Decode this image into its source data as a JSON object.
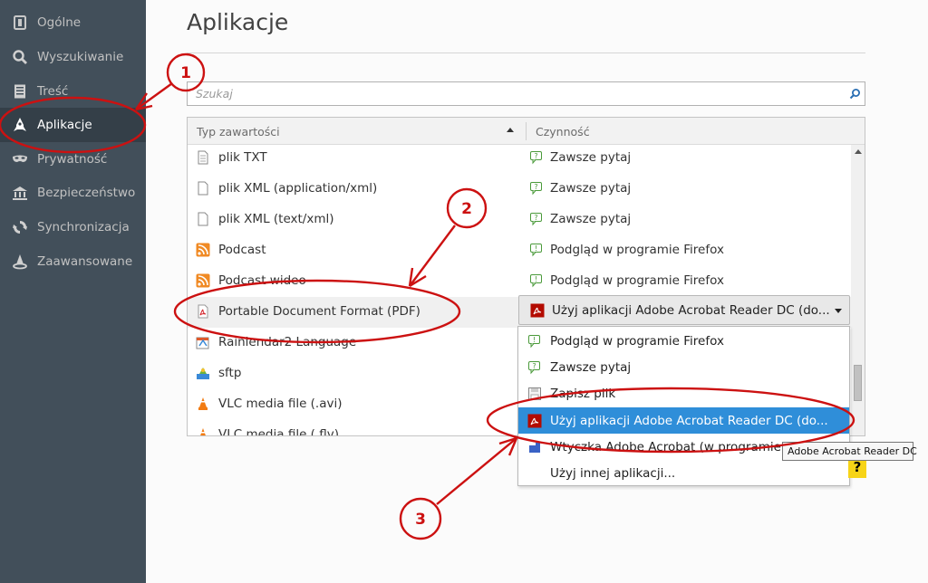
{
  "sidebar": {
    "items": [
      {
        "label": "Ogólne",
        "icon": "general-icon"
      },
      {
        "label": "Wyszukiwanie",
        "icon": "search-icon"
      },
      {
        "label": "Treść",
        "icon": "content-icon"
      },
      {
        "label": "Aplikacje",
        "icon": "applications-icon",
        "active": true
      },
      {
        "label": "Prywatność",
        "icon": "privacy-mask-icon"
      },
      {
        "label": "Bezpieczeństwo",
        "icon": "security-icon"
      },
      {
        "label": "Synchronizacja",
        "icon": "sync-icon"
      },
      {
        "label": "Zaawansowane",
        "icon": "advanced-icon"
      }
    ]
  },
  "main": {
    "title": "Aplikacje",
    "search_placeholder": "Szukaj"
  },
  "table": {
    "col_type": "Typ zawartości",
    "col_action": "Czynność",
    "rows": [
      {
        "type": "plik TXT",
        "type_icon": "file-icon",
        "action": "Zawsze pytaj",
        "action_icon": "ask-icon"
      },
      {
        "type": "plik XML (application/xml)",
        "type_icon": "file-icon",
        "action": "Zawsze pytaj",
        "action_icon": "ask-icon"
      },
      {
        "type": "plik XML (text/xml)",
        "type_icon": "file-icon",
        "action": "Zawsze pytaj",
        "action_icon": "ask-icon"
      },
      {
        "type": "Podcast",
        "type_icon": "rss-icon",
        "action": "Podgląd w programie Firefox",
        "action_icon": "preview-icon"
      },
      {
        "type": "Podcast wideo",
        "type_icon": "rss-icon",
        "action": "Podgląd w programie Firefox",
        "action_icon": "preview-icon"
      },
      {
        "type": "Portable Document Format (PDF)",
        "type_icon": "pdf-icon",
        "action": "",
        "action_icon": ""
      },
      {
        "type": "Rainlendar2 Language",
        "type_icon": "calendar-icon",
        "action": "",
        "action_icon": ""
      },
      {
        "type": "sftp",
        "type_icon": "sftp-icon",
        "action": "",
        "action_icon": ""
      },
      {
        "type": "VLC media file (.avi)",
        "type_icon": "vlc-icon",
        "action": "",
        "action_icon": ""
      },
      {
        "type": "VLC media file (.flv)",
        "type_icon": "vlc-icon",
        "action": "",
        "action_icon": ""
      }
    ],
    "combo_selected": "Użyj aplikacji Adobe Acrobat Reader DC  (do...",
    "dropdown": [
      {
        "label": "Podgląd w programie Firefox",
        "icon": "preview-icon"
      },
      {
        "label": "Zawsze pytaj",
        "icon": "ask-icon"
      },
      {
        "label": "Zapisz plik",
        "icon": "save-icon"
      },
      {
        "label": "Użyj aplikacji Adobe Acrobat Reader DC  (do...",
        "icon": "acrobat-icon",
        "highlighted": true
      },
      {
        "label": "Wtyczka Adobe Acrobat (w programie Fi",
        "icon": "plugin-icon"
      },
      {
        "label": "Użyj innej aplikacji...",
        "icon": ""
      }
    ]
  },
  "tooltip": "Adobe Acrobat Reader DC",
  "help_label": "?",
  "annotations": {
    "markers": [
      "1",
      "2",
      "3"
    ]
  },
  "colors": {
    "sidebar_bg": "#424f5a",
    "sidebar_active": "#343f48",
    "highlight": "#2f8ed9",
    "annotation_red": "#cc1111"
  }
}
